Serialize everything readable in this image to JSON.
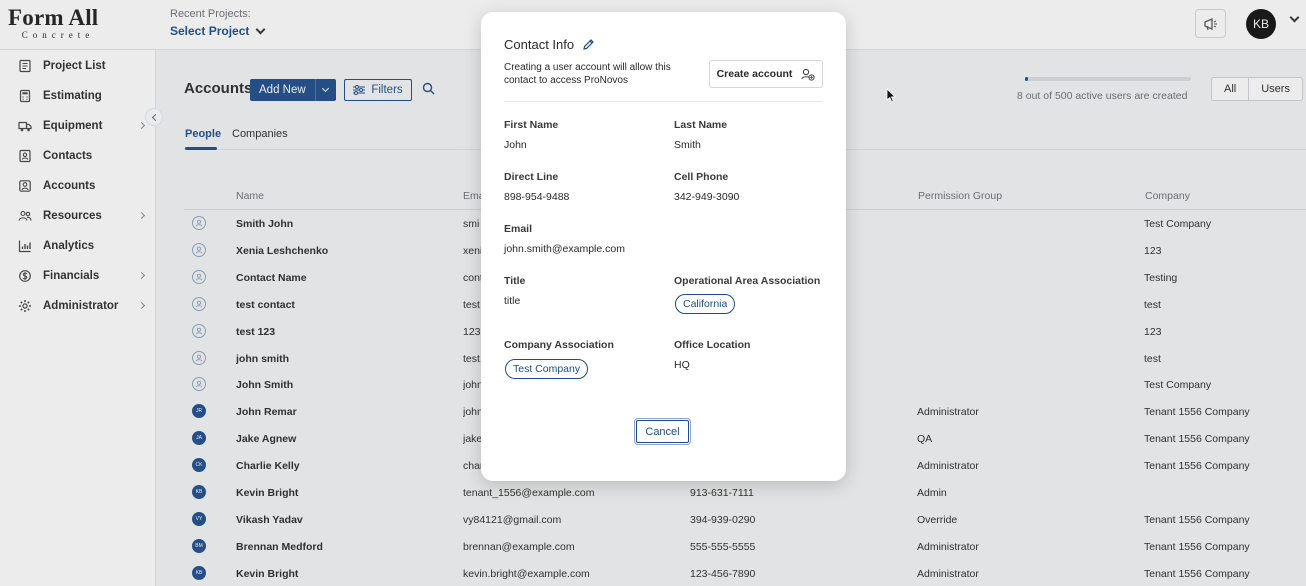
{
  "brand": {
    "name": "Form All",
    "sub": "Concrete"
  },
  "header": {
    "recent_label": "Recent Projects:",
    "select_project": "Select Project",
    "avatar_initials": "KB"
  },
  "sidebar": {
    "items": [
      {
        "label": "Project List",
        "icon": "project-list-icon",
        "arrow": false
      },
      {
        "label": "Estimating",
        "icon": "calculator-icon",
        "arrow": false
      },
      {
        "label": "Equipment",
        "icon": "truck-icon",
        "arrow": true
      },
      {
        "label": "Contacts",
        "icon": "contact-card-icon",
        "arrow": false
      },
      {
        "label": "Accounts",
        "icon": "account-icon",
        "arrow": false
      },
      {
        "label": "Resources",
        "icon": "people-icon",
        "arrow": true
      },
      {
        "label": "Analytics",
        "icon": "chart-icon",
        "arrow": false
      },
      {
        "label": "Financials",
        "icon": "money-icon",
        "arrow": true
      },
      {
        "label": "Administrator",
        "icon": "gear-icon",
        "arrow": true
      }
    ]
  },
  "main": {
    "title": "Accounts",
    "add_new": "Add New",
    "filters": "Filters",
    "tabs": [
      "People",
      "Companies"
    ],
    "users_count": "8 out of 500 active users are created",
    "users_fraction": 0.016,
    "segment": [
      "All",
      "Users"
    ],
    "columns": {
      "name": "Name",
      "email": "Ema",
      "permission": "Permission Group",
      "company": "Company"
    },
    "rows": [
      {
        "name": "Smith John",
        "email": "smi",
        "phone": "",
        "perm": "",
        "company": "Test Company",
        "avatar": ""
      },
      {
        "name": "Xenia Leshchenko",
        "email": "xeni",
        "phone": "",
        "perm": "",
        "company": "123",
        "avatar": ""
      },
      {
        "name": "Contact Name",
        "email": "cont",
        "phone": "",
        "perm": "",
        "company": "Testing",
        "avatar": ""
      },
      {
        "name": "test contact",
        "email": "test",
        "phone": "",
        "perm": "",
        "company": "test",
        "avatar": ""
      },
      {
        "name": "test 123",
        "email": "123",
        "phone": "",
        "perm": "",
        "company": "123",
        "avatar": ""
      },
      {
        "name": "john smith",
        "email": "test.",
        "phone": "",
        "perm": "",
        "company": "test",
        "avatar": ""
      },
      {
        "name": "John Smith",
        "email": "john",
        "phone": "",
        "perm": "",
        "company": "Test Company",
        "avatar": ""
      },
      {
        "name": "John Remar",
        "email": "john",
        "phone": "",
        "perm": "Administrator",
        "company": "Tenant 1556 Company",
        "avatar": "JR"
      },
      {
        "name": "Jake Agnew",
        "email": "jake",
        "phone": "",
        "perm": "QA",
        "company": "Tenant 1556 Company",
        "avatar": "JA"
      },
      {
        "name": "Charlie Kelly",
        "email": "char",
        "phone": "",
        "perm": "Administrator",
        "company": "Tenant 1556 Company",
        "avatar": "CK"
      },
      {
        "name": "Kevin Bright",
        "email": "tenant_1556@example.com",
        "phone": "913-631-7111",
        "perm": "Admin",
        "company": "",
        "avatar": "KB"
      },
      {
        "name": "Vikash Yadav",
        "email": "vy84121@gmail.com",
        "phone": "394-939-0290",
        "perm": "Override",
        "company": "Tenant 1556 Company",
        "avatar": "VY"
      },
      {
        "name": "Brennan Medford",
        "email": "brennan@example.com",
        "phone": "555-555-5555",
        "perm": "Administrator",
        "company": "Tenant 1556 Company",
        "avatar": "BM"
      },
      {
        "name": "Kevin Bright",
        "email": "kevin.bright@example.com",
        "phone": "123-456-7890",
        "perm": "Administrator",
        "company": "Tenant 1556 Company",
        "avatar": "KB"
      }
    ]
  },
  "modal": {
    "title": "Contact Info",
    "description": "Creating a user account will allow this contact to access ProNovos",
    "create_account": "Create account",
    "first_name_label": "First Name",
    "first_name": "John",
    "last_name_label": "Last Name",
    "last_name": "Smith",
    "direct_line_label": "Direct Line",
    "direct_line": "898-954-9488",
    "cell_phone_label": "Cell Phone",
    "cell_phone": "342-949-3090",
    "email_label": "Email",
    "email": "john.smith@example.com",
    "title_label": "Title",
    "title_value": "title",
    "area_label": "Operational Area Association",
    "area_chip": "California",
    "company_label": "Company Association",
    "company_chip": "Test Company",
    "office_label": "Office Location",
    "office": "HQ",
    "cancel": "Cancel"
  },
  "colors": {
    "primary": "#1d4c8c",
    "background": "#f4f5f6"
  }
}
